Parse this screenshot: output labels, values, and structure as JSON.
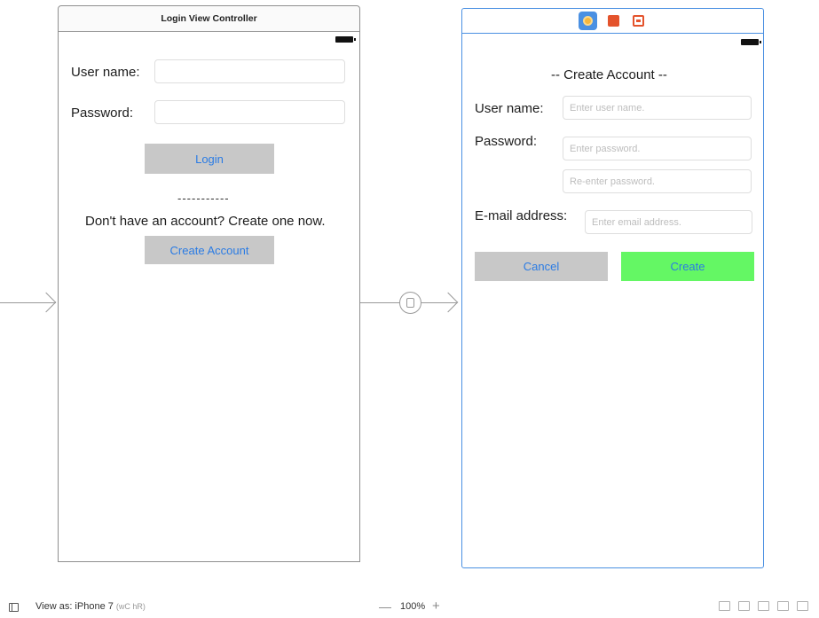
{
  "login_scene": {
    "title": "Login View Controller",
    "username_label": "User name:",
    "password_label": "Password:",
    "login_button": "Login",
    "separator": "-----------",
    "prompt": "Don't have an account? Create one now.",
    "create_account_button": "Create Account"
  },
  "create_scene": {
    "heading": "-- Create Account --",
    "username_label": "User name:",
    "username_placeholder": "Enter user name.",
    "password_label": "Password:",
    "password_placeholder": "Enter password.",
    "reenter_placeholder": "Re-enter password.",
    "email_label": "E-mail address:",
    "email_placeholder": "Enter email address.",
    "cancel_button": "Cancel",
    "create_button": "Create"
  },
  "bottom_bar": {
    "view_as": "View as: iPhone 7",
    "size_class": "(wC hR)",
    "zoom_minus": "—",
    "zoom": "100%",
    "zoom_plus": "+"
  },
  "icons": {
    "sidebar": "sidebar-toggle-icon",
    "vc": "view-controller-icon",
    "first_responder": "first-responder-cube-icon",
    "exit": "exit-icon",
    "segue": "segue-icon"
  },
  "colors": {
    "button_gray": "#c8c8c8",
    "button_green": "#64f764",
    "link_blue": "#2a7be4",
    "selection_blue": "#4a90e2"
  }
}
